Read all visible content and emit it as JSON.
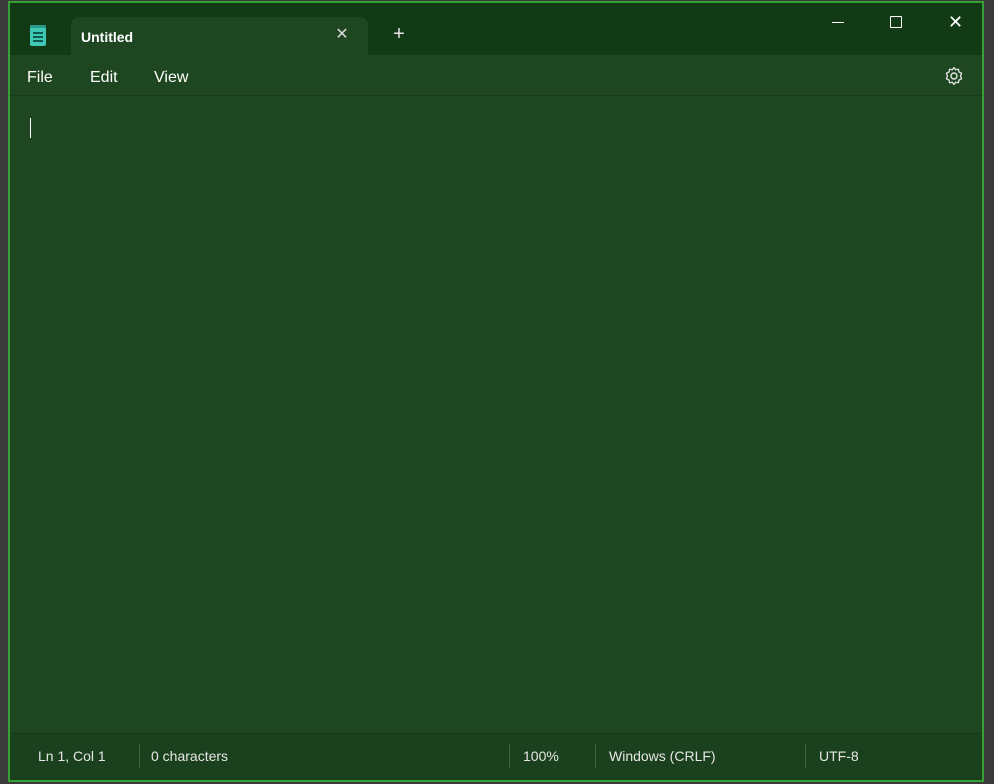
{
  "titlebar": {
    "app_icon": "notepad-icon",
    "tab_title": "Untitled",
    "tab_close_glyph": "✕",
    "new_tab_glyph": "+",
    "minimize_icon": "minimize-icon",
    "maximize_icon": "maximize-icon",
    "close_glyph": "✕"
  },
  "menu": {
    "items": [
      {
        "label": "File"
      },
      {
        "label": "Edit"
      },
      {
        "label": "View"
      }
    ],
    "settings_icon": "gear-icon"
  },
  "editor": {
    "content": ""
  },
  "statusbar": {
    "position": "Ln 1, Col 1",
    "characters": "0 characters",
    "zoom": "100%",
    "line_endings": "Windows (CRLF)",
    "encoding": "UTF-8"
  },
  "colors": {
    "window_bg": "#1e4620",
    "titlebar_bg": "#123a14",
    "border": "#35a035",
    "text": "#ffffff"
  }
}
